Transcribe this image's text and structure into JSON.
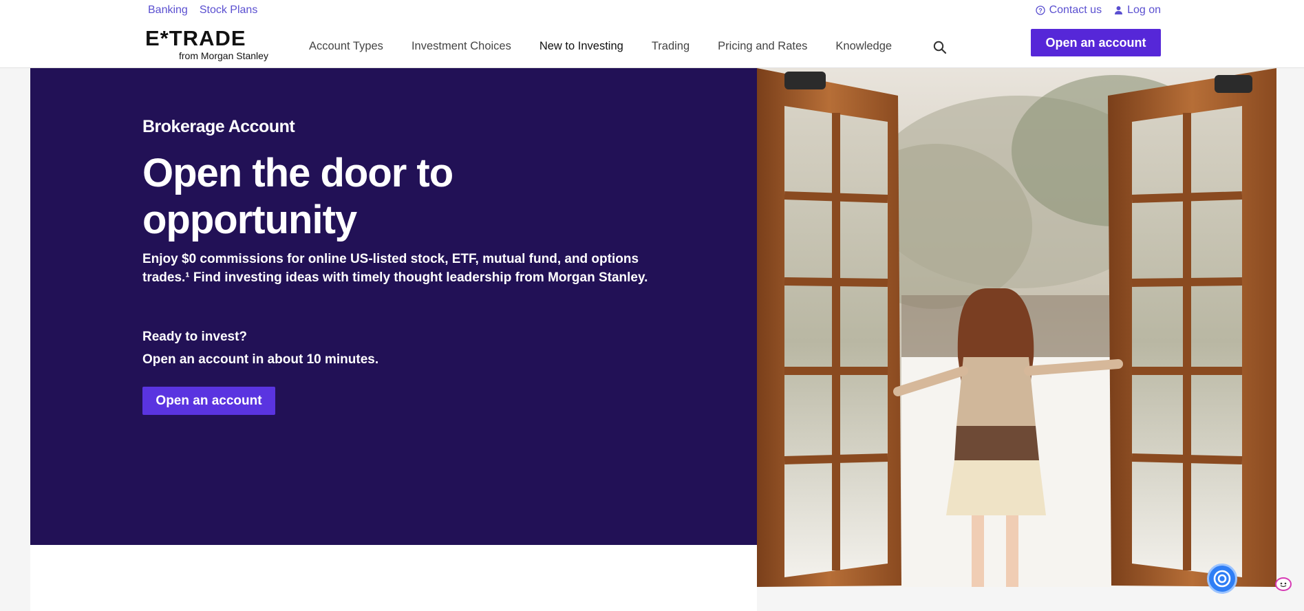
{
  "utility_nav": {
    "banking": "Banking",
    "stock_plans": "Stock Plans",
    "contact_us": "Contact us",
    "log_on": "Log on"
  },
  "logo": {
    "wordmark": "E*TRADE",
    "subline": "from Morgan Stanley"
  },
  "main_nav": [
    {
      "label": "Account Types"
    },
    {
      "label": "Investment Choices"
    },
    {
      "label": "New to Investing"
    },
    {
      "label": "Trading"
    },
    {
      "label": "Pricing and Rates"
    },
    {
      "label": "Knowledge"
    }
  ],
  "header_cta": "Open an account",
  "hero": {
    "eyebrow": "Brokerage Account",
    "headline": "Open the door to opportunity",
    "lede": "Enjoy $0 commissions for online US-listed stock, ETF, mutual fund, and options trades.¹ Find investing ideas with timely thought leadership from Morgan Stanley.",
    "ready": "Ready to invest?",
    "minutes": "Open an account in about 10 minutes.",
    "cta": "Open an account"
  },
  "colors": {
    "brand_purple": "#5627d8",
    "hero_bg": "#221156",
    "link": "#5a4fd0"
  },
  "icons": {
    "search": "search-icon",
    "contact": "help-circle-icon",
    "log_on": "person-icon",
    "chat": "chat-assistant-icon"
  }
}
